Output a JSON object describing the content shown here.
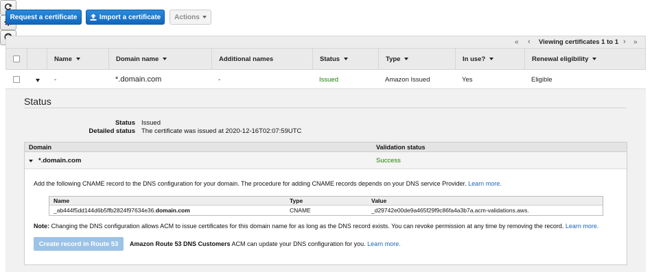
{
  "toolbar": {
    "request_label": "Request a certificate",
    "import_label": "Import a certificate",
    "actions_label": "Actions"
  },
  "pager": {
    "text": "Viewing certificates 1 to 1",
    "first": "«",
    "prev": "‹",
    "next": "›",
    "last": "»"
  },
  "table": {
    "headers": [
      "Name",
      "Domain name",
      "Additional names",
      "Status",
      "Type",
      "In use?",
      "Renewal eligibility"
    ],
    "row": {
      "name": "-",
      "domain": "*.domain.com",
      "additional": "-",
      "status": "Issued",
      "type": "Amazon Issued",
      "in_use": "Yes",
      "renewal": "Eligible"
    }
  },
  "details": {
    "title": "Status",
    "status_label": "Status",
    "status_value": "Issued",
    "detailed_label": "Detailed status",
    "detailed_value": "The certificate was issued at 2020-12-16T02:07:59UTC",
    "validation": {
      "col_domain": "Domain",
      "col_status": "Validation status",
      "domain": "*.domain.com",
      "status": "Success",
      "instruction": "Add the following CNAME record to the DNS configuration for your domain. The procedure for adding CNAME records depends on your DNS service Provider.",
      "learn_more": "Learn more.",
      "record": {
        "h_name": "Name",
        "h_type": "Type",
        "h_value": "Value",
        "name_prefix": "_ab444f5dd144d6b5ffb2824f97634e36.",
        "name_domain": "domain.com",
        "type": "CNAME",
        "value": "_d29742e00de9a465f29f9c86fa4a3b7a.acm-validations.aws."
      },
      "note_label": "Note:",
      "note_text": "Changing the DNS configuration allows ACM to issue certificates for this domain name for as long as the DNS record exists. You can revoke permission at any time by removing the record.",
      "note_link": "Learn more.",
      "route53_button": "Create record in Route 53",
      "route53_bold": "Amazon Route 53 DNS Customers",
      "route53_text": "ACM can update your DNS configuration for you.",
      "route53_link": "Learn more."
    }
  },
  "colors": {
    "primary": "#1a6fc4",
    "success": "#1d8102",
    "link": "#1a64b4"
  }
}
